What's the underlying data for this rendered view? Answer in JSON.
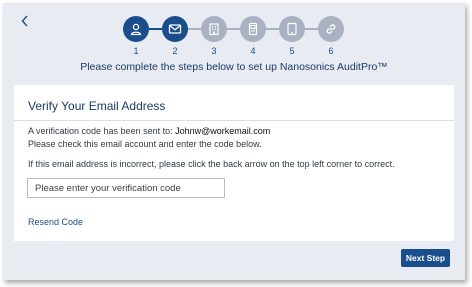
{
  "header": {
    "back_icon": "chevron-left-icon",
    "instruction": "Please complete the steps below to set up Nanosonics AuditPro™"
  },
  "stepper": {
    "active_color": "#1a4d8c",
    "inactive_color": "#a9b1c2",
    "steps": [
      {
        "number": "1",
        "icon": "user-icon",
        "state": "completed"
      },
      {
        "number": "2",
        "icon": "envelope-icon",
        "state": "current"
      },
      {
        "number": "3",
        "icon": "building-icon",
        "state": "upcoming"
      },
      {
        "number": "4",
        "icon": "device-icon",
        "state": "upcoming"
      },
      {
        "number": "5",
        "icon": "tablet-icon",
        "state": "upcoming"
      },
      {
        "number": "6",
        "icon": "link-icon",
        "state": "upcoming"
      }
    ]
  },
  "card": {
    "title": "Verify Your Email Address",
    "sent_to_prefix": "A verification code has been sent to: ",
    "email": "Johnw@workemail.com",
    "check_instruction": "Please check this email account and enter the code below.",
    "incorrect_note": "If this email address is incorrect, please click the back arrow on the top left corner to correct.",
    "code_input": {
      "value": "",
      "placeholder": "Please enter your verification code"
    },
    "resend_label": "Resend Code"
  },
  "footer": {
    "next_label": "Next Step"
  }
}
